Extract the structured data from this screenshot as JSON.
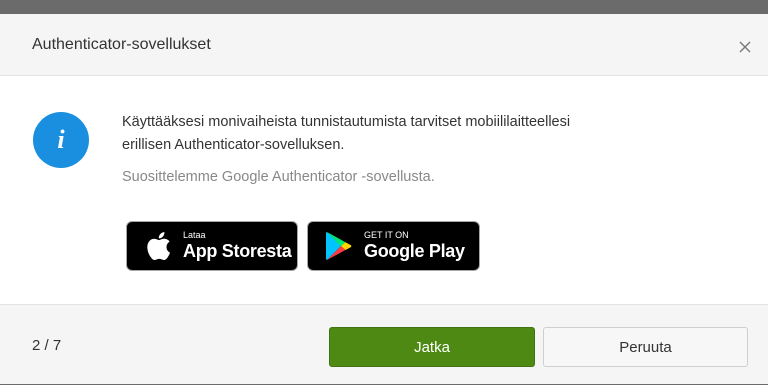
{
  "dialog": {
    "title": "Authenticator-sovellukset",
    "close_icon": "close-icon"
  },
  "message": {
    "icon": "info-icon",
    "icon_glyph": "i",
    "line1": "Käyttääksesi monivaiheista tunnistautumista tarvitset mobiililaitteellesi",
    "line2": "erillisen Authenticator-sovelluksen.",
    "recommendation": "Suosittelemme Google Authenticator -sovellusta."
  },
  "stores": {
    "appstore": {
      "icon": "apple-icon",
      "small": "Lataa",
      "large": "App Storesta"
    },
    "googleplay": {
      "icon": "google-play-icon",
      "small": "GET IT ON",
      "large": "Google Play"
    }
  },
  "footer": {
    "step": "2 / 7",
    "primary_label": "Jatka",
    "secondary_label": "Peruuta"
  },
  "colors": {
    "primary": "#4e8a13",
    "info": "#1a8fe0"
  }
}
